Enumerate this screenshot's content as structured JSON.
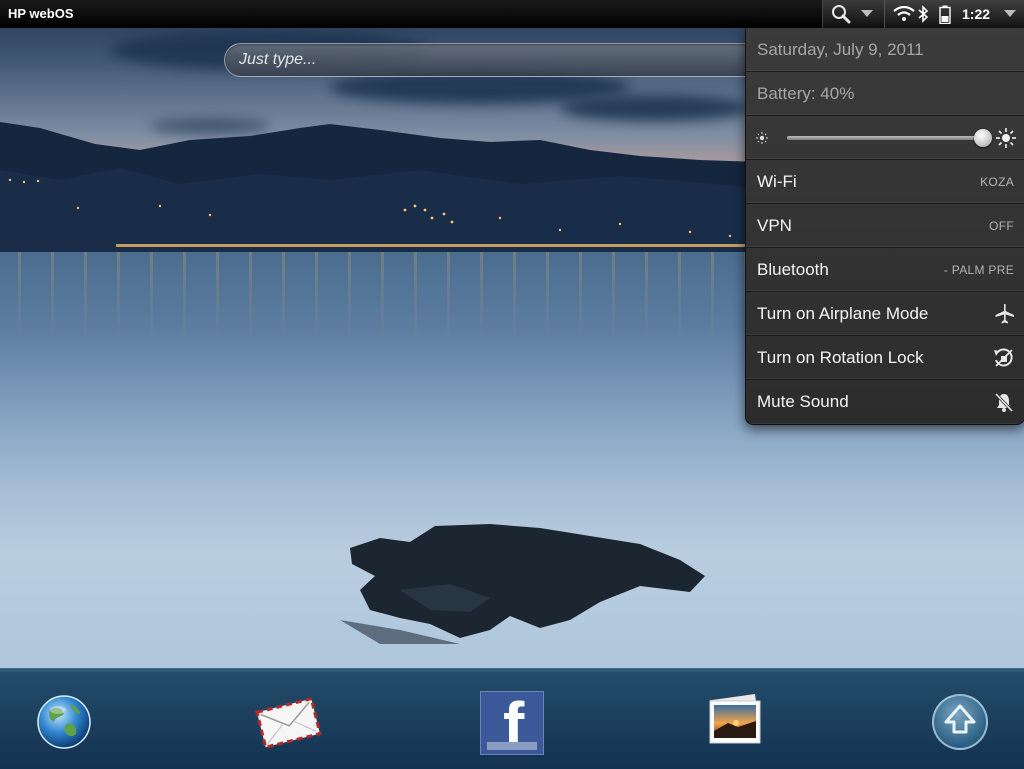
{
  "status_bar": {
    "device_name": "HP webOS",
    "time": "1:22",
    "icons": [
      "search-icon",
      "wifi-icon",
      "bluetooth-icon",
      "battery-icon"
    ]
  },
  "just_type": {
    "placeholder": "Just type..."
  },
  "system_menu": {
    "date": "Saturday, July 9, 2011",
    "battery": "Battery: 40%",
    "brightness_level": 1.0,
    "items": [
      {
        "label": "Wi-Fi",
        "value": "KOZA"
      },
      {
        "label": "VPN",
        "value": "OFF"
      },
      {
        "label": "Bluetooth",
        "value": "- PALM PRE"
      },
      {
        "label": "Turn on Airplane Mode",
        "icon": "airplane-icon"
      },
      {
        "label": "Turn on Rotation Lock",
        "icon": "rotation-lock-icon"
      },
      {
        "label": "Mute Sound",
        "icon": "mute-icon"
      }
    ]
  },
  "dock": {
    "apps": [
      "web-browser-icon",
      "email-icon",
      "facebook-icon",
      "photos-icon",
      "launcher-icon"
    ],
    "facebook_glyph": "f"
  },
  "colors": {
    "status_bar": "#000000",
    "menu_bg": "#333333",
    "menu_text": "#f4f4f4",
    "dock": "#1e4a70"
  }
}
